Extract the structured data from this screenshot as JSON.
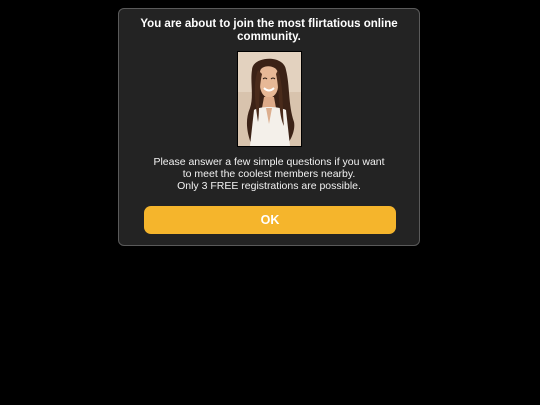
{
  "modal": {
    "title": "You are about to join the most flirtatious online community.",
    "photo": {
      "icon": "woman-portrait-photo"
    },
    "message_lines": [
      "Please answer a few simple questions if you want",
      "to meet the coolest members nearby.",
      "Only 3 FREE registrations are possible."
    ],
    "ok_label": "OK"
  },
  "colors": {
    "background": "#000000",
    "modal_background": "#232323",
    "modal_border": "#5a5a5a",
    "button": "#f5b52c",
    "button_text": "#ffffff"
  }
}
